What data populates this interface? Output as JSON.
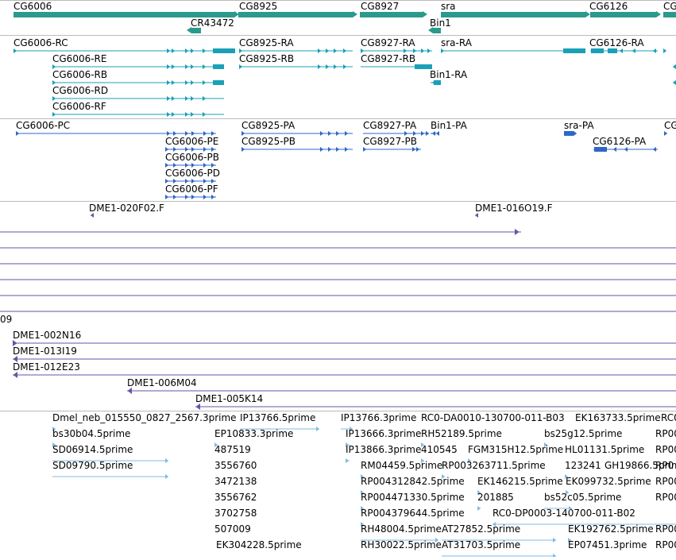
{
  "colors": {
    "gene": "#2b9a8c",
    "transcript": "#1aa0b8",
    "protein": "#2f67c8",
    "clone": "#6a52a8",
    "est": "#7fbce2",
    "divider": "#bbbbbb"
  },
  "genes": [
    {
      "label": "CG6006",
      "bar_icon": "gene-bar"
    },
    {
      "label": "CR43472",
      "bar_icon": "gene-bar"
    },
    {
      "label": "CG8925",
      "bar_icon": "gene-bar"
    },
    {
      "label": "CG8927",
      "bar_icon": "gene-bar"
    },
    {
      "label": "sra",
      "bar_icon": "gene-bar"
    },
    {
      "label": "Bin1",
      "bar_icon": "gene-bar"
    },
    {
      "label": "CG6126",
      "bar_icon": "gene-bar"
    },
    {
      "label": "CG",
      "bar_icon": "gene-bar"
    }
  ],
  "transcripts": [
    {
      "label": "CG6006-RC"
    },
    {
      "label": "CG6006-RE"
    },
    {
      "label": "CG6006-RB"
    },
    {
      "label": "CG6006-RD"
    },
    {
      "label": "CG6006-RF"
    },
    {
      "label": "CG8925-RA"
    },
    {
      "label": "CG8925-RB"
    },
    {
      "label": "CG8927-RA"
    },
    {
      "label": "CG8927-RB"
    },
    {
      "label": "sra-RA"
    },
    {
      "label": "Bin1-RA"
    },
    {
      "label": "CG6126-RA"
    }
  ],
  "proteins": [
    {
      "label": "CG6006-PC"
    },
    {
      "label": "CG6006-PE"
    },
    {
      "label": "CG6006-PB"
    },
    {
      "label": "CG6006-PD"
    },
    {
      "label": "CG6006-PF"
    },
    {
      "label": "CG8925-PA"
    },
    {
      "label": "CG8925-PB"
    },
    {
      "label": "CG8927-PA"
    },
    {
      "label": "CG8927-PB"
    },
    {
      "label": "Bin1-PA"
    },
    {
      "label": "sra-PA"
    },
    {
      "label": "CG6126-PA"
    },
    {
      "label": "CG"
    }
  ],
  "clones": [
    {
      "label": "DME1-020F02.F"
    },
    {
      "label": "DME1-016O19.F"
    },
    {
      "label": "09"
    },
    {
      "label": "DME1-002N16"
    },
    {
      "label": "DME1-013I19"
    },
    {
      "label": "DME1-012E23"
    },
    {
      "label": "DME1-006M04"
    },
    {
      "label": "DME1-005K14"
    }
  ],
  "ests": [
    {
      "label": "Dmel_neb_015550_0827_2567.3prime"
    },
    {
      "label": "bs30b04.5prime"
    },
    {
      "label": "SD06914.5prime"
    },
    {
      "label": "SD09790.5prime"
    },
    {
      "label": "IP13766.5prime"
    },
    {
      "label": "EP10833.3prime"
    },
    {
      "label": "487519"
    },
    {
      "label": "3556760"
    },
    {
      "label": "3472138"
    },
    {
      "label": "3556762"
    },
    {
      "label": "3702758"
    },
    {
      "label": "507009"
    },
    {
      "label": "EK304228.5prime"
    },
    {
      "label": "IP13766.3prime"
    },
    {
      "label": "IP13666.3prime"
    },
    {
      "label": "IP13866.3prime"
    },
    {
      "label": "RM04459.5prime"
    },
    {
      "label": "RP004312842.5prime"
    },
    {
      "label": "RP004471330.5prime"
    },
    {
      "label": "RP004379644.5prime"
    },
    {
      "label": "RH48004.5prime"
    },
    {
      "label": "RH30022.5prime"
    },
    {
      "label": "RC0-DA0010-130700-011-B03"
    },
    {
      "label": "RH52189.5prime"
    },
    {
      "label": "410545"
    },
    {
      "label": "FGM315H12.5prime"
    },
    {
      "label": "RP003263711.5prime"
    },
    {
      "label": "EK146215.5prime"
    },
    {
      "label": "201885"
    },
    {
      "label": "AT27852.5prime"
    },
    {
      "label": "AT31703.5prime"
    },
    {
      "label": "RC0-DP0003-140700-011-B02"
    },
    {
      "label": "bs25g12.5prime"
    },
    {
      "label": "HL01131.5prime"
    },
    {
      "label": "123241"
    },
    {
      "label": "GH19866.5prime"
    },
    {
      "label": "EK099732.5prime"
    },
    {
      "label": "bs52c05.5prime"
    },
    {
      "label": "EK192762.5prime"
    },
    {
      "label": "EP07451.3prime"
    },
    {
      "label": "EK163733.5prime"
    },
    {
      "label": "RC0"
    },
    {
      "label": "RP00"
    },
    {
      "label": "RP00"
    },
    {
      "label": "RP0"
    },
    {
      "label": "RP00"
    },
    {
      "label": "RP00"
    },
    {
      "label": "RP00"
    },
    {
      "label": "RP00"
    }
  ]
}
